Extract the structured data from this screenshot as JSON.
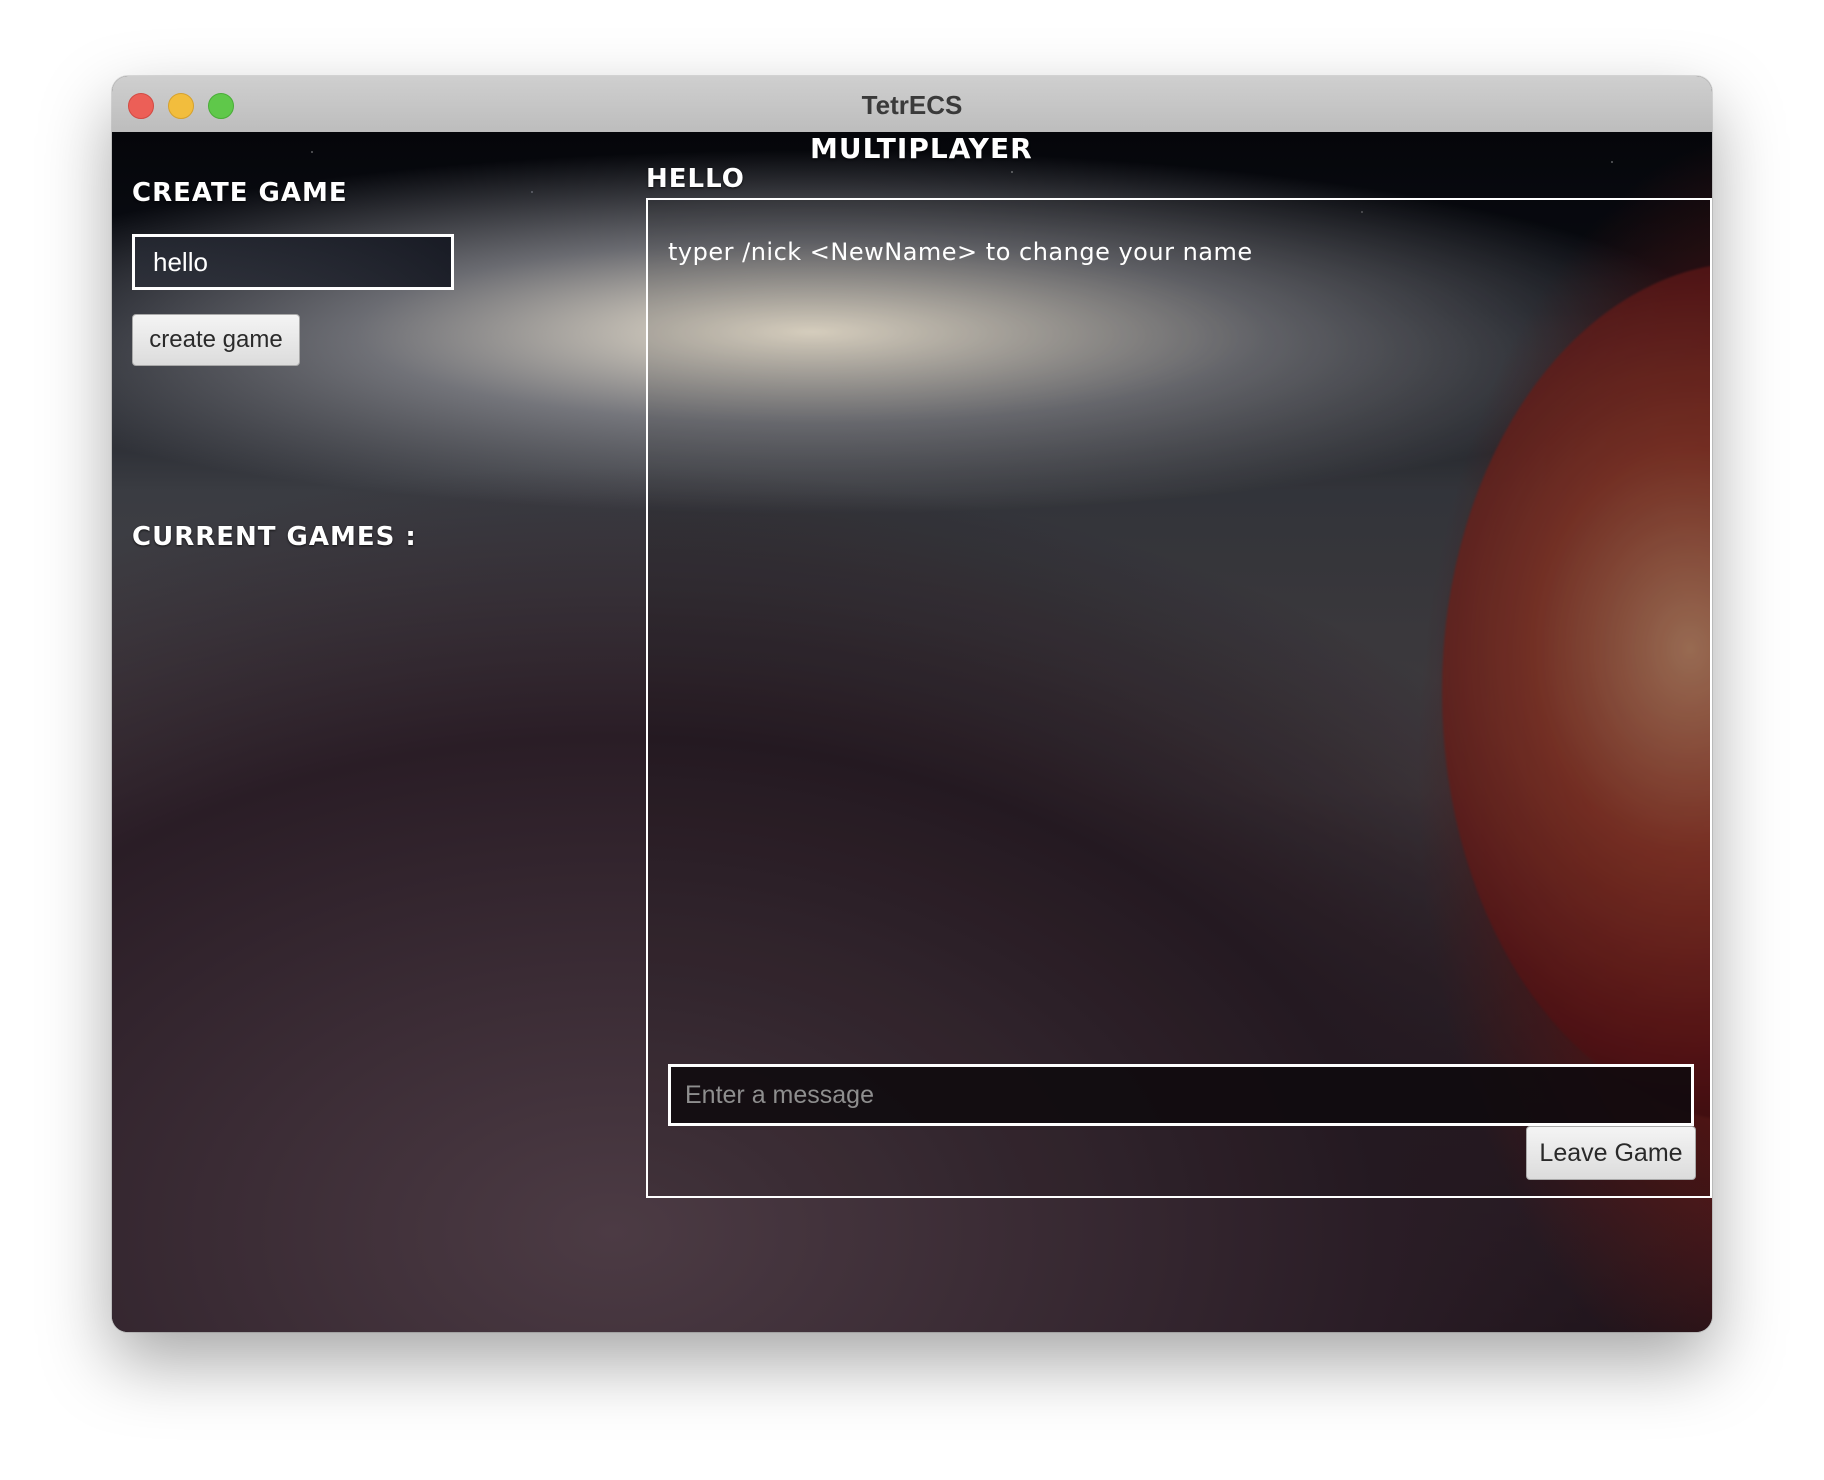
{
  "window": {
    "title": "TetrECS"
  },
  "screen": {
    "title": "MULTIPLAYER"
  },
  "create_game": {
    "heading": "CREATE GAME",
    "name_value": "hello",
    "button_label": "create game"
  },
  "current_games": {
    "heading": "CURRENT GAMES :",
    "items": []
  },
  "chat": {
    "channel_name": "HELLO",
    "hint": "typer /nick <NewName> to change your name",
    "input_placeholder": "Enter a message",
    "input_value": "",
    "leave_label": "Leave Game"
  },
  "colors": {
    "panel_border": "#ffffff",
    "button_bg": "#e8e8e8",
    "planet_accent": "#8c2a24"
  },
  "icons": {
    "close": "close-icon",
    "minimize": "minimize-icon",
    "maximize": "maximize-icon"
  }
}
